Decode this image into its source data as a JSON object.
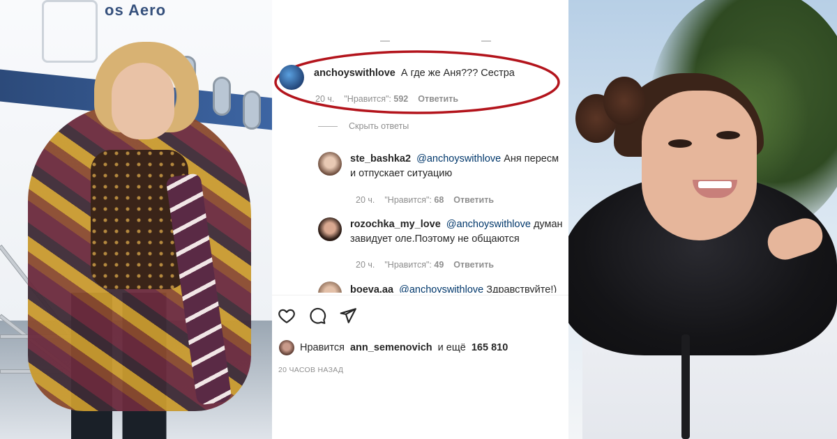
{
  "plane": {
    "brand": "os Aero"
  },
  "comments": [
    {
      "username": "anchoyswithlove",
      "text": "А где же Аня??? Сестра",
      "time": "20 ч.",
      "likes_label": "\"Нравится\":",
      "likes_count": "592",
      "reply_label": "Ответить",
      "highlighted": true
    }
  ],
  "hide_replies_label": "Скрыть ответы",
  "replies": [
    {
      "username": "ste_bashka2",
      "mention": "@anchoyswithlove",
      "line1": "Аня пересм",
      "line2": "и отпускает ситуацию",
      "time": "20 ч.",
      "likes_label": "\"Нравится\":",
      "likes_count": "68",
      "reply_label": "Ответить"
    },
    {
      "username": "rozochka_my_love",
      "mention": "@anchoyswithlove",
      "line1": "думан",
      "line2": "завидует оле.Поэтому не общаются",
      "time": "20 ч.",
      "likes_label": "\"Нравится\":",
      "likes_count": "49",
      "reply_label": "Ответить"
    },
    {
      "username": "boeva.aa",
      "mention": "@anchoyswithlove",
      "line1": "Здравствуйте!)",
      "line2": ""
    }
  ],
  "actions": {
    "like_icon": "heart-icon",
    "comment_icon": "comment-icon",
    "share_icon": "paper-plane-icon"
  },
  "likes_summary": {
    "prefix": "Нравится",
    "user": "ann_semenovich",
    "suffix": "и ещё",
    "count": "165 810"
  },
  "posted_ago": "20 ЧАСОВ НАЗАД",
  "colors": {
    "highlight_oval": "#b3141c",
    "mention": "#00376b",
    "meta_gray": "#8e8e8e"
  }
}
